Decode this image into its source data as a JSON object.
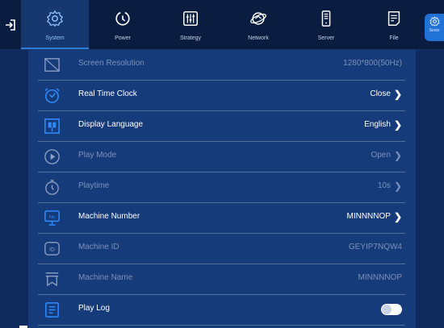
{
  "tabs": [
    {
      "label": "System",
      "icon": "gear-icon",
      "active": true
    },
    {
      "label": "Power",
      "icon": "power-icon",
      "active": false
    },
    {
      "label": "Strategy",
      "icon": "strategy-icon",
      "active": false
    },
    {
      "label": "Network",
      "icon": "network-icon",
      "active": false
    },
    {
      "label": "Server",
      "icon": "server-icon",
      "active": false
    },
    {
      "label": "File",
      "icon": "file-icon",
      "active": false
    }
  ],
  "right_tab": {
    "label": "Senio",
    "icon": "gear-icon"
  },
  "settings": [
    {
      "label": "Screen Resolution",
      "value": "1280*800(50Hz)",
      "icon": "screen-icon",
      "enabled": false,
      "chevron": false
    },
    {
      "label": "Real Time Clock",
      "value": "Close",
      "icon": "alarm-clock-icon",
      "enabled": true,
      "chevron": true
    },
    {
      "label": "Display Language",
      "value": "English",
      "icon": "language-icon",
      "enabled": true,
      "chevron": true
    },
    {
      "label": "Play Mode",
      "value": "Open",
      "icon": "play-icon",
      "enabled": false,
      "chevron": true
    },
    {
      "label": "Playtime",
      "value": "10s",
      "icon": "stopwatch-icon",
      "enabled": false,
      "chevron": true
    },
    {
      "label": "Machine Number",
      "value": "MINNNNOP",
      "icon": "monitor-icon",
      "enabled": true,
      "chevron": true
    },
    {
      "label": "Machine ID",
      "value": "GEYIP7NQW4",
      "icon": "id-icon",
      "enabled": false,
      "chevron": false
    },
    {
      "label": "Machine Name",
      "value": "MINNNNOP",
      "icon": "tag-icon",
      "enabled": false,
      "chevron": false
    },
    {
      "label": "Play Log",
      "value": "",
      "icon": "log-icon",
      "enabled": true,
      "toggle": true,
      "toggle_on": false
    }
  ],
  "chevron_glyph": "❯",
  "colors": {
    "background": "#0f2a5c",
    "panel": "#163b7a",
    "accent": "#2172d6",
    "topbar": "#0a1c3f"
  }
}
